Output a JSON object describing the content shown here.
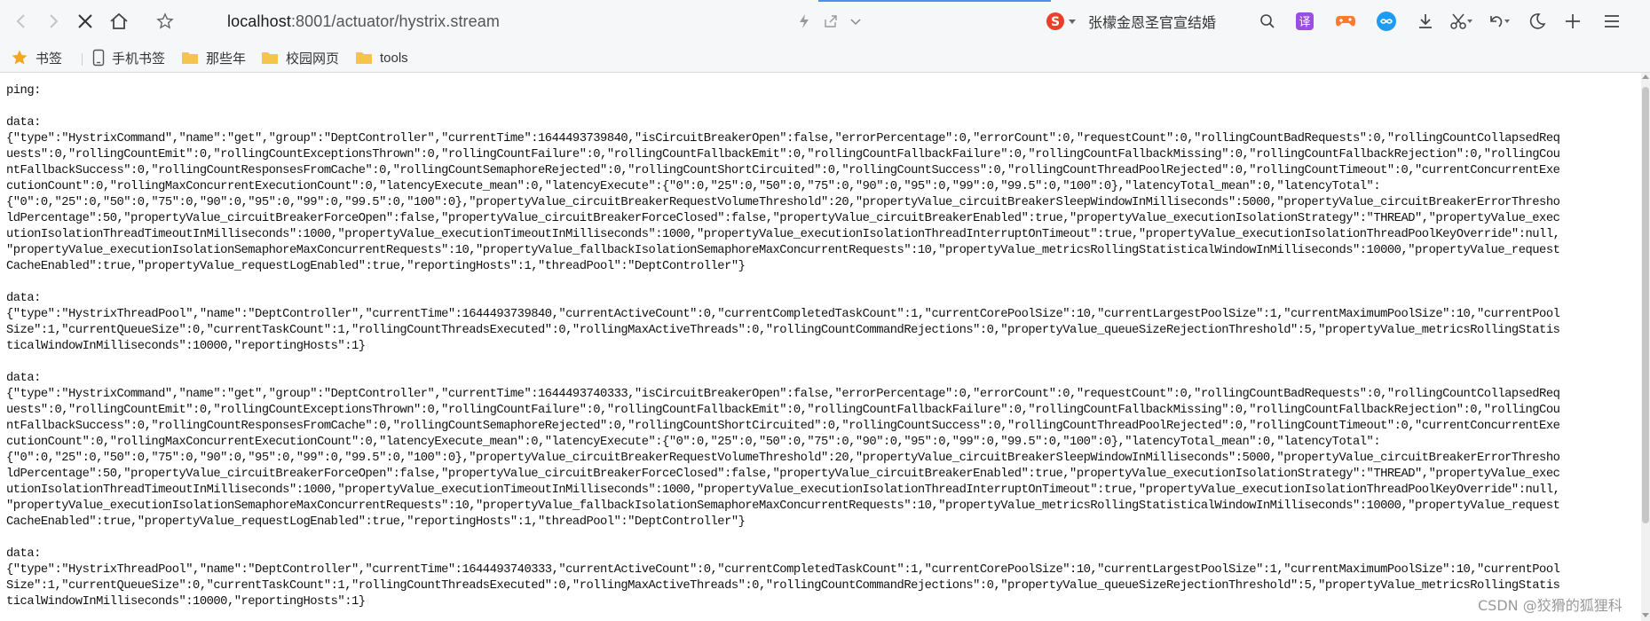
{
  "toolbar": {
    "url_host": "localhost",
    "url_rest": ":8001/actuator/hystrix.stream",
    "search_text": "张檬金恩圣官宣结婚"
  },
  "bookmarks": [
    {
      "label": "书签",
      "icon": "star-icon"
    },
    {
      "label": "手机书签",
      "icon": "phone-icon"
    },
    {
      "label": "那些年",
      "icon": "folder-icon"
    },
    {
      "label": "校园网页",
      "icon": "folder-icon"
    },
    {
      "label": "tools",
      "icon": "folder-icon"
    }
  ],
  "colors": {
    "accent": "#4d8ef0",
    "toolbar_bg": "#f6f7f8",
    "folder": "#f4c54a",
    "star": "#f5a623",
    "translate": "#9b4fe0",
    "game": "#ff7a2d",
    "extension": "#1d9cf0"
  },
  "stream_lines": [
    "ping:",
    "",
    "data:",
    "{\"type\":\"HystrixCommand\",\"name\":\"get\",\"group\":\"DeptController\",\"currentTime\":1644493739840,\"isCircuitBreakerOpen\":false,\"errorPercentage\":0,\"errorCount\":0,\"requestCount\":0,\"rollingCountBadRequests\":0,\"rollingCountCollapsedReq",
    "uests\":0,\"rollingCountEmit\":0,\"rollingCountExceptionsThrown\":0,\"rollingCountFailure\":0,\"rollingCountFallbackEmit\":0,\"rollingCountFallbackFailure\":0,\"rollingCountFallbackMissing\":0,\"rollingCountFallbackRejection\":0,\"rollingCou",
    "ntFallbackSuccess\":0,\"rollingCountResponsesFromCache\":0,\"rollingCountSemaphoreRejected\":0,\"rollingCountShortCircuited\":0,\"rollingCountSuccess\":0,\"rollingCountThreadPoolRejected\":0,\"rollingCountTimeout\":0,\"currentConcurrentExe",
    "cutionCount\":0,\"rollingMaxConcurrentExecutionCount\":0,\"latencyExecute_mean\":0,\"latencyExecute\":{\"0\":0,\"25\":0,\"50\":0,\"75\":0,\"90\":0,\"95\":0,\"99\":0,\"99.5\":0,\"100\":0},\"latencyTotal_mean\":0,\"latencyTotal\":",
    "{\"0\":0,\"25\":0,\"50\":0,\"75\":0,\"90\":0,\"95\":0,\"99\":0,\"99.5\":0,\"100\":0},\"propertyValue_circuitBreakerRequestVolumeThreshold\":20,\"propertyValue_circuitBreakerSleepWindowInMilliseconds\":5000,\"propertyValue_circuitBreakerErrorThresho",
    "ldPercentage\":50,\"propertyValue_circuitBreakerForceOpen\":false,\"propertyValue_circuitBreakerForceClosed\":false,\"propertyValue_circuitBreakerEnabled\":true,\"propertyValue_executionIsolationStrategy\":\"THREAD\",\"propertyValue_exec",
    "utionIsolationThreadTimeoutInMilliseconds\":1000,\"propertyValue_executionTimeoutInMilliseconds\":1000,\"propertyValue_executionIsolationThreadInterruptOnTimeout\":true,\"propertyValue_executionIsolationThreadPoolKeyOverride\":null,",
    "\"propertyValue_executionIsolationSemaphoreMaxConcurrentRequests\":10,\"propertyValue_fallbackIsolationSemaphoreMaxConcurrentRequests\":10,\"propertyValue_metricsRollingStatisticalWindowInMilliseconds\":10000,\"propertyValue_request",
    "CacheEnabled\":true,\"propertyValue_requestLogEnabled\":true,\"reportingHosts\":1,\"threadPool\":\"DeptController\"}",
    "",
    "data:",
    "{\"type\":\"HystrixThreadPool\",\"name\":\"DeptController\",\"currentTime\":1644493739840,\"currentActiveCount\":0,\"currentCompletedTaskCount\":1,\"currentCorePoolSize\":10,\"currentLargestPoolSize\":1,\"currentMaximumPoolSize\":10,\"currentPool",
    "Size\":1,\"currentQueueSize\":0,\"currentTaskCount\":1,\"rollingCountThreadsExecuted\":0,\"rollingMaxActiveThreads\":0,\"rollingCountCommandRejections\":0,\"propertyValue_queueSizeRejectionThreshold\":5,\"propertyValue_metricsRollingStatis",
    "ticalWindowInMilliseconds\":10000,\"reportingHosts\":1}",
    "",
    "data:",
    "{\"type\":\"HystrixCommand\",\"name\":\"get\",\"group\":\"DeptController\",\"currentTime\":1644493740333,\"isCircuitBreakerOpen\":false,\"errorPercentage\":0,\"errorCount\":0,\"requestCount\":0,\"rollingCountBadRequests\":0,\"rollingCountCollapsedReq",
    "uests\":0,\"rollingCountEmit\":0,\"rollingCountExceptionsThrown\":0,\"rollingCountFailure\":0,\"rollingCountFallbackEmit\":0,\"rollingCountFallbackFailure\":0,\"rollingCountFallbackMissing\":0,\"rollingCountFallbackRejection\":0,\"rollingCou",
    "ntFallbackSuccess\":0,\"rollingCountResponsesFromCache\":0,\"rollingCountSemaphoreRejected\":0,\"rollingCountShortCircuited\":0,\"rollingCountSuccess\":0,\"rollingCountThreadPoolRejected\":0,\"rollingCountTimeout\":0,\"currentConcurrentExe",
    "cutionCount\":0,\"rollingMaxConcurrentExecutionCount\":0,\"latencyExecute_mean\":0,\"latencyExecute\":{\"0\":0,\"25\":0,\"50\":0,\"75\":0,\"90\":0,\"95\":0,\"99\":0,\"99.5\":0,\"100\":0},\"latencyTotal_mean\":0,\"latencyTotal\":",
    "{\"0\":0,\"25\":0,\"50\":0,\"75\":0,\"90\":0,\"95\":0,\"99\":0,\"99.5\":0,\"100\":0},\"propertyValue_circuitBreakerRequestVolumeThreshold\":20,\"propertyValue_circuitBreakerSleepWindowInMilliseconds\":5000,\"propertyValue_circuitBreakerErrorThresho",
    "ldPercentage\":50,\"propertyValue_circuitBreakerForceOpen\":false,\"propertyValue_circuitBreakerForceClosed\":false,\"propertyValue_circuitBreakerEnabled\":true,\"propertyValue_executionIsolationStrategy\":\"THREAD\",\"propertyValue_exec",
    "utionIsolationThreadTimeoutInMilliseconds\":1000,\"propertyValue_executionTimeoutInMilliseconds\":1000,\"propertyValue_executionIsolationThreadInterruptOnTimeout\":true,\"propertyValue_executionIsolationThreadPoolKeyOverride\":null,",
    "\"propertyValue_executionIsolationSemaphoreMaxConcurrentRequests\":10,\"propertyValue_fallbackIsolationSemaphoreMaxConcurrentRequests\":10,\"propertyValue_metricsRollingStatisticalWindowInMilliseconds\":10000,\"propertyValue_request",
    "CacheEnabled\":true,\"propertyValue_requestLogEnabled\":true,\"reportingHosts\":1,\"threadPool\":\"DeptController\"}",
    "",
    "data:",
    "{\"type\":\"HystrixThreadPool\",\"name\":\"DeptController\",\"currentTime\":1644493740333,\"currentActiveCount\":0,\"currentCompletedTaskCount\":1,\"currentCorePoolSize\":10,\"currentLargestPoolSize\":1,\"currentMaximumPoolSize\":10,\"currentPool",
    "Size\":1,\"currentQueueSize\":0,\"currentTaskCount\":1,\"rollingCountThreadsExecuted\":0,\"rollingMaxActiveThreads\":0,\"rollingCountCommandRejections\":0,\"propertyValue_queueSizeRejectionThreshold\":5,\"propertyValue_metricsRollingStatis",
    "ticalWindowInMilliseconds\":10000,\"reportingHosts\":1}"
  ],
  "watermark": "CSDN @狡猾的狐狸科"
}
